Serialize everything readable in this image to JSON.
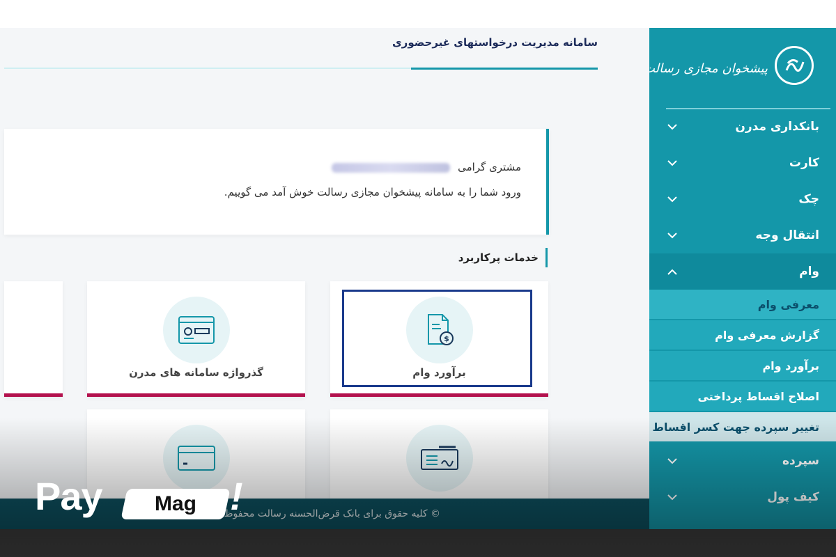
{
  "header": {
    "title": "سامانه مدیریت درخواستهای غیرحضوری"
  },
  "logo": {
    "text": "پیشخوان مجازی رسالت"
  },
  "sidebar": {
    "items": [
      {
        "label": "بانکداری مدرن"
      },
      {
        "label": "کارت"
      },
      {
        "label": "چک"
      },
      {
        "label": "انتقال وجه"
      },
      {
        "label": "وام"
      }
    ],
    "loan_submenu": [
      {
        "label": "معرفی وام"
      },
      {
        "label": "گزارش معرفی وام"
      },
      {
        "label": "برآورد وام"
      },
      {
        "label": "اصلاح اقساط پرداختی"
      },
      {
        "label": "تغییر سپرده جهت کسر اقساط"
      }
    ],
    "more_items": [
      {
        "label": "سپرده"
      },
      {
        "label": "کیف پول"
      }
    ]
  },
  "welcome": {
    "greeting": "مشتری گرامی",
    "message": "ورود شما را به سامانه پیشخوان مجازی رسالت خوش آمد می گوییم."
  },
  "services": {
    "title": "خدمات پرکاربرد",
    "cards": [
      {
        "label": "برآورد وام",
        "icon": "loan-document-icon"
      },
      {
        "label": "گذرواژه سامانه های مدرن",
        "icon": "id-card-icon"
      }
    ]
  },
  "footer": {
    "text": "© کلیه حقوق برای بانک قرض‌الحسنه رسالت محفوظ"
  },
  "watermark": {
    "pay": "Pay",
    "mag": "Mag",
    "bang": "!"
  },
  "colors": {
    "teal": "#1497a9",
    "accent": "#b3114d",
    "footer": "#0d4f5e"
  }
}
